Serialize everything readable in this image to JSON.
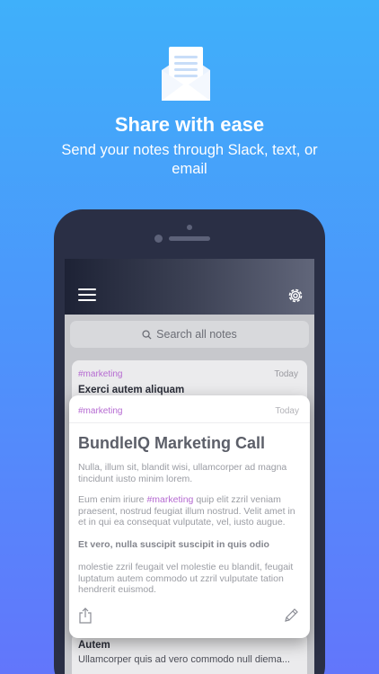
{
  "hero": {
    "icon": "envelope-note-icon",
    "title": "Share with ease",
    "subtitle": "Send your notes through Slack, text, or email"
  },
  "app": {
    "icons": {
      "menu": "hamburger-menu-icon",
      "settings": "gear-icon",
      "search": "search-icon"
    },
    "search_placeholder": "Search all notes",
    "notes": [
      {
        "tag": "#marketing",
        "date": "Today",
        "title": "Exerci autem aliquam"
      }
    ],
    "bottom_note": {
      "title": "Autem",
      "snippet": "Ullamcorper quis ad vero commodo null diema..."
    },
    "expanded_note": {
      "tag": "#marketing",
      "date": "Today",
      "title": "BundleIQ Marketing Call",
      "paragraph1": "Nulla, illum sit, blandit wisi, ullamcorper ad magna tincidunt iusto minim lorem.",
      "paragraph2_before": "Eum enim iriure ",
      "paragraph2_hashtag": "#marketing",
      "paragraph2_after": " quip elit zzril veniam praesent, nostrud feugiat illum nostrud. Velit amet in et in qui ea consequat vulputate, vel, iusto augue.",
      "paragraph3": "Et vero, nulla suscipit suscipit in quis odio",
      "paragraph4": "molestie zzril feugait vel molestie eu blandit, feugait luptatum autem commodo ut zzril vulputate tation hendrerit euismod.",
      "icons": {
        "share": "share-icon",
        "edit": "pencil-icon"
      }
    }
  },
  "colors": {
    "gradient_top": "#3fb0fa",
    "gradient_bottom": "#6276fb",
    "hashtag": "#b56ad1",
    "phone_frame": "#2a2f45"
  }
}
